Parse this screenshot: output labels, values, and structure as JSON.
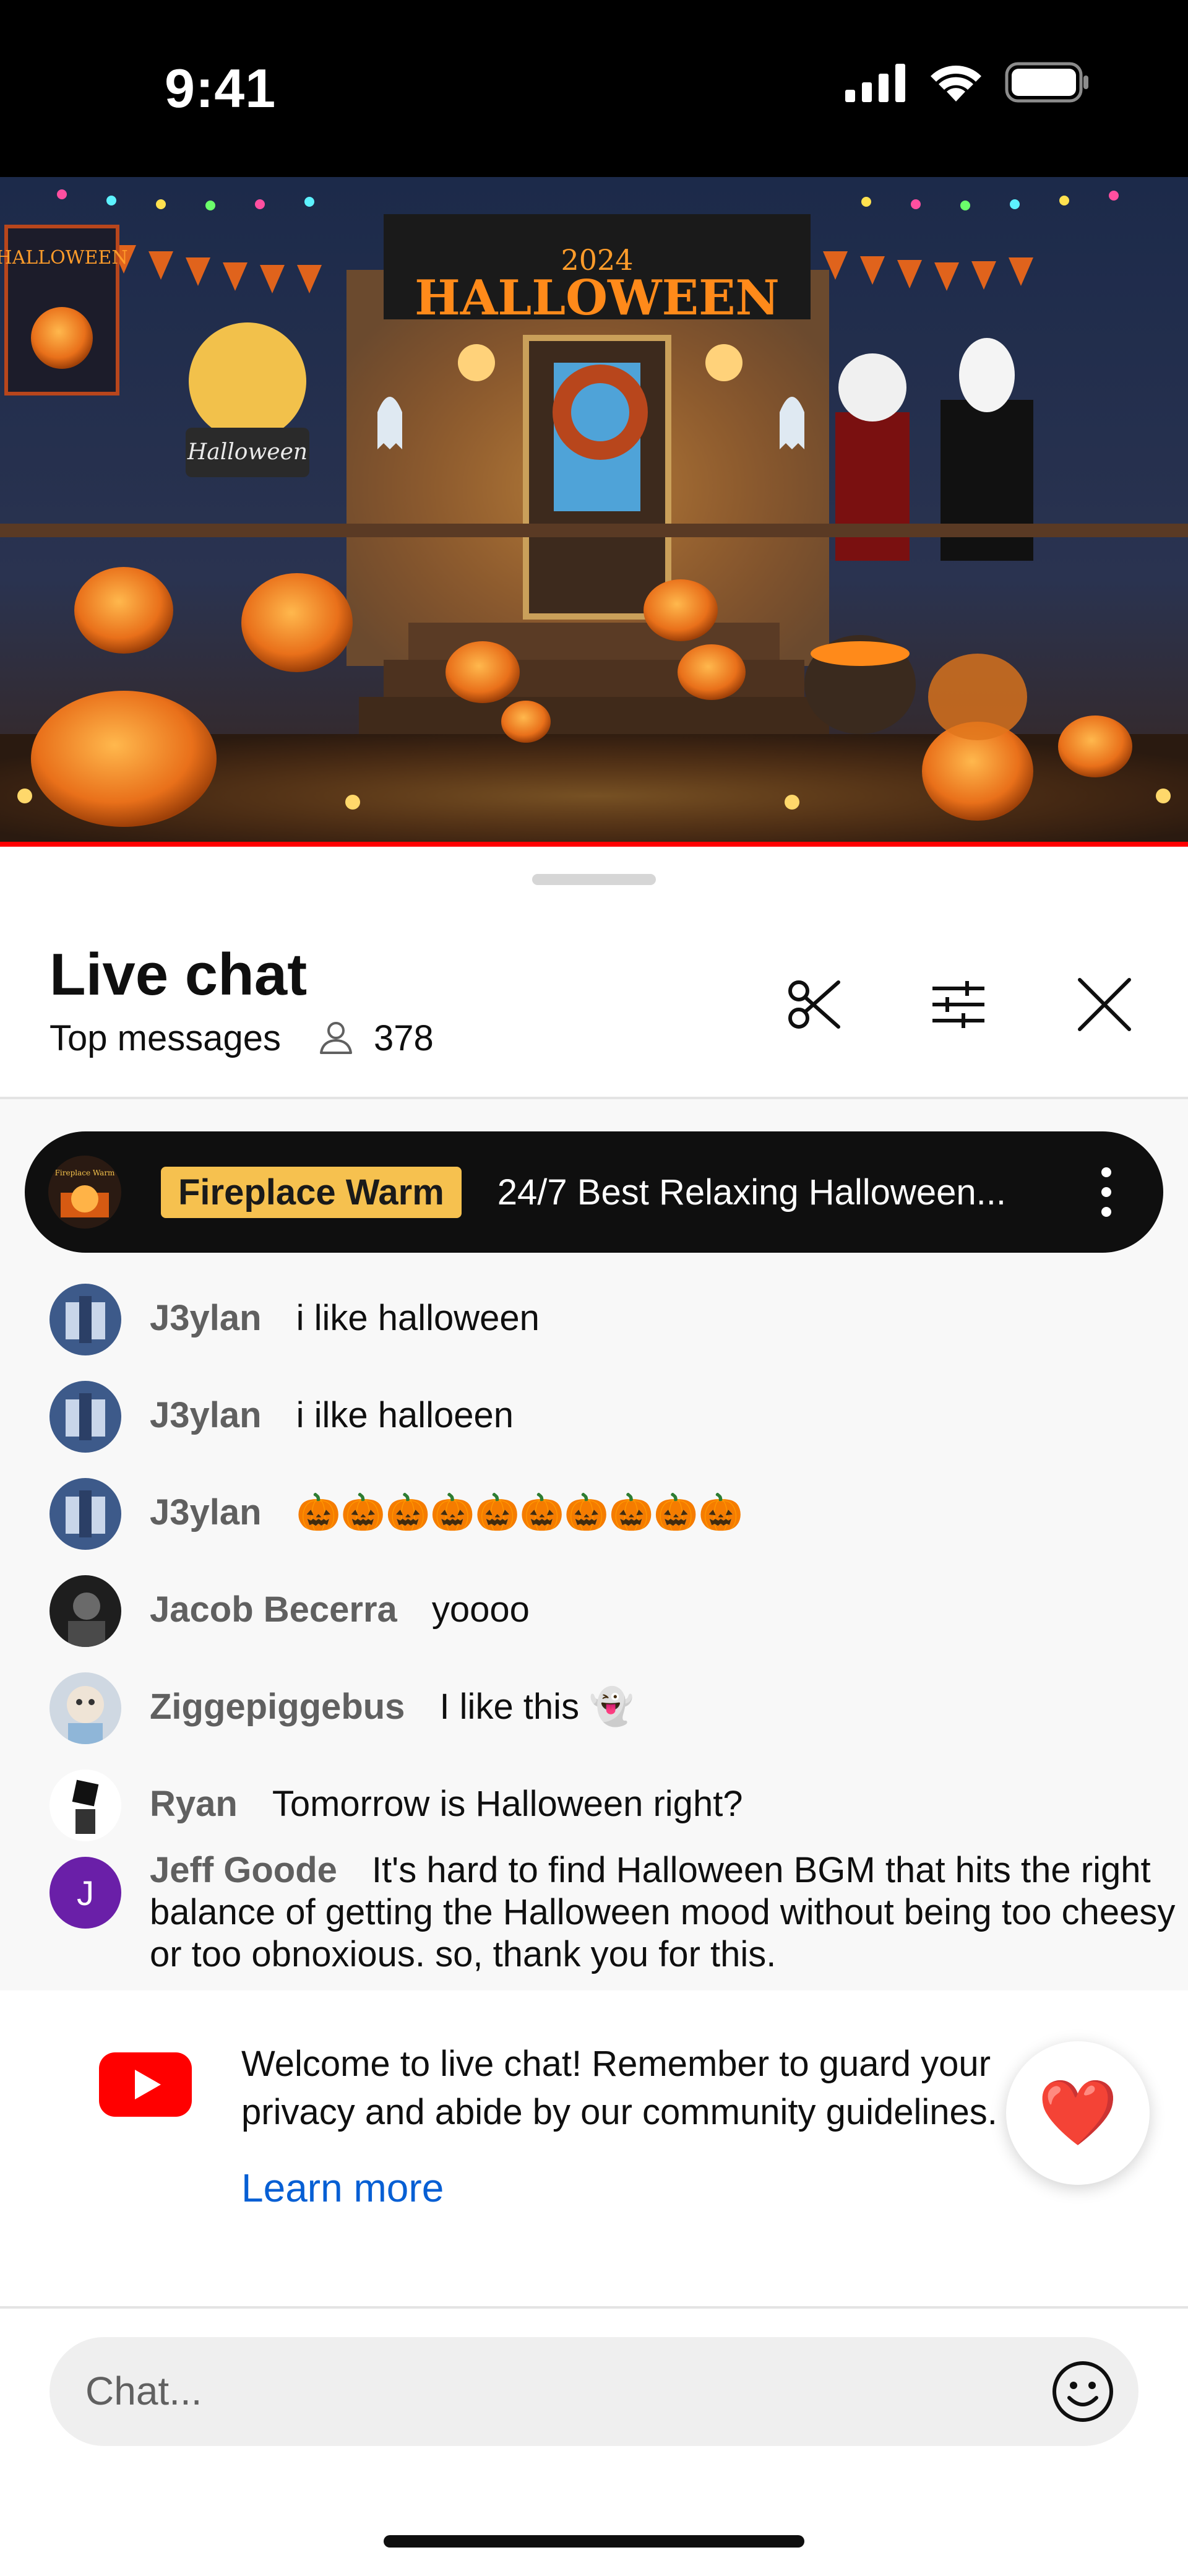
{
  "status_bar": {
    "time": "9:41",
    "icons": [
      "signal-icon",
      "wifi-icon",
      "battery-icon"
    ]
  },
  "video": {
    "banner_year": "2024",
    "banner_title": "HALLOWEEN",
    "banner_flag": "HALLOWEEN",
    "sign_text": "Halloween"
  },
  "header": {
    "title": "Live chat",
    "mode": "Top messages",
    "viewer_count": "378",
    "buttons": [
      "clip-icon",
      "filter-icon",
      "close-icon"
    ]
  },
  "pinned": {
    "thumb_label": "Fireplace Warm",
    "channel": "Fireplace Warm",
    "text": "24/7 Best Relaxing Halloween..."
  },
  "messages": [
    {
      "author": "J3ylan",
      "text": "i like halloween",
      "avatar": "j3ylan-avatar"
    },
    {
      "author": "J3ylan",
      "text": "i ilke halloeen",
      "avatar": "j3ylan-avatar"
    },
    {
      "author": "J3ylan",
      "text": "🎃🎃🎃🎃🎃🎃🎃🎃🎃🎃",
      "avatar": "j3ylan-avatar"
    },
    {
      "author": "Jacob Becerra",
      "text": "yoooo",
      "avatar": "jacob-avatar"
    },
    {
      "author": "Ziggepiggebus",
      "text": "I like this 👻",
      "avatar": "ziggepiggebus-avatar"
    },
    {
      "author": "Ryan",
      "text": "Tomorrow is Halloween right?",
      "avatar": "ryan-avatar"
    },
    {
      "author": "Jeff Goode",
      "text": "It's hard to find Halloween BGM that hits the right balance of getting the Halloween mood without being too cheesy or too obnoxious. so, thank you for this.",
      "avatar_letter": "J"
    }
  ],
  "welcome": {
    "text": "Welcome to live chat! Remember to guard your privacy and abide by our community guidelines.",
    "link": "Learn more",
    "reaction": "❤️"
  },
  "input": {
    "placeholder": "Chat..."
  },
  "colors": {
    "accent_red": "#ff0000",
    "link_blue": "#065fd4",
    "badge_yellow": "#f6c14f",
    "jeff_avatar": "#6a1fa8"
  }
}
